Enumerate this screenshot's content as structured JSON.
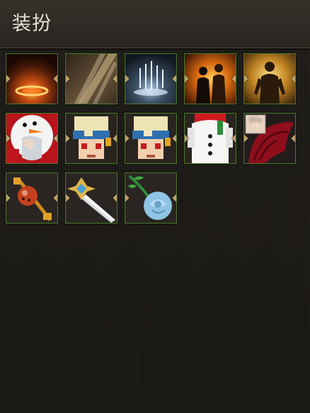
{
  "panel": {
    "title": "装扮"
  },
  "items": [
    {
      "name": "aura-fire-ring-item"
    },
    {
      "name": "aura-light-beams-item"
    },
    {
      "name": "aura-ice-sparkle-item"
    },
    {
      "name": "aura-fire-silhouettes-item"
    },
    {
      "name": "aura-golden-silhouette-item"
    },
    {
      "name": "snowman-hood-character-item"
    },
    {
      "name": "pixel-hat-avatar-item"
    },
    {
      "name": "pixel-hat-avatar-item"
    },
    {
      "name": "snowman-costume-item"
    },
    {
      "name": "red-wings-item"
    },
    {
      "name": "orange-mace-item"
    },
    {
      "name": "ornate-sword-item"
    },
    {
      "name": "blue-rose-item"
    }
  ]
}
